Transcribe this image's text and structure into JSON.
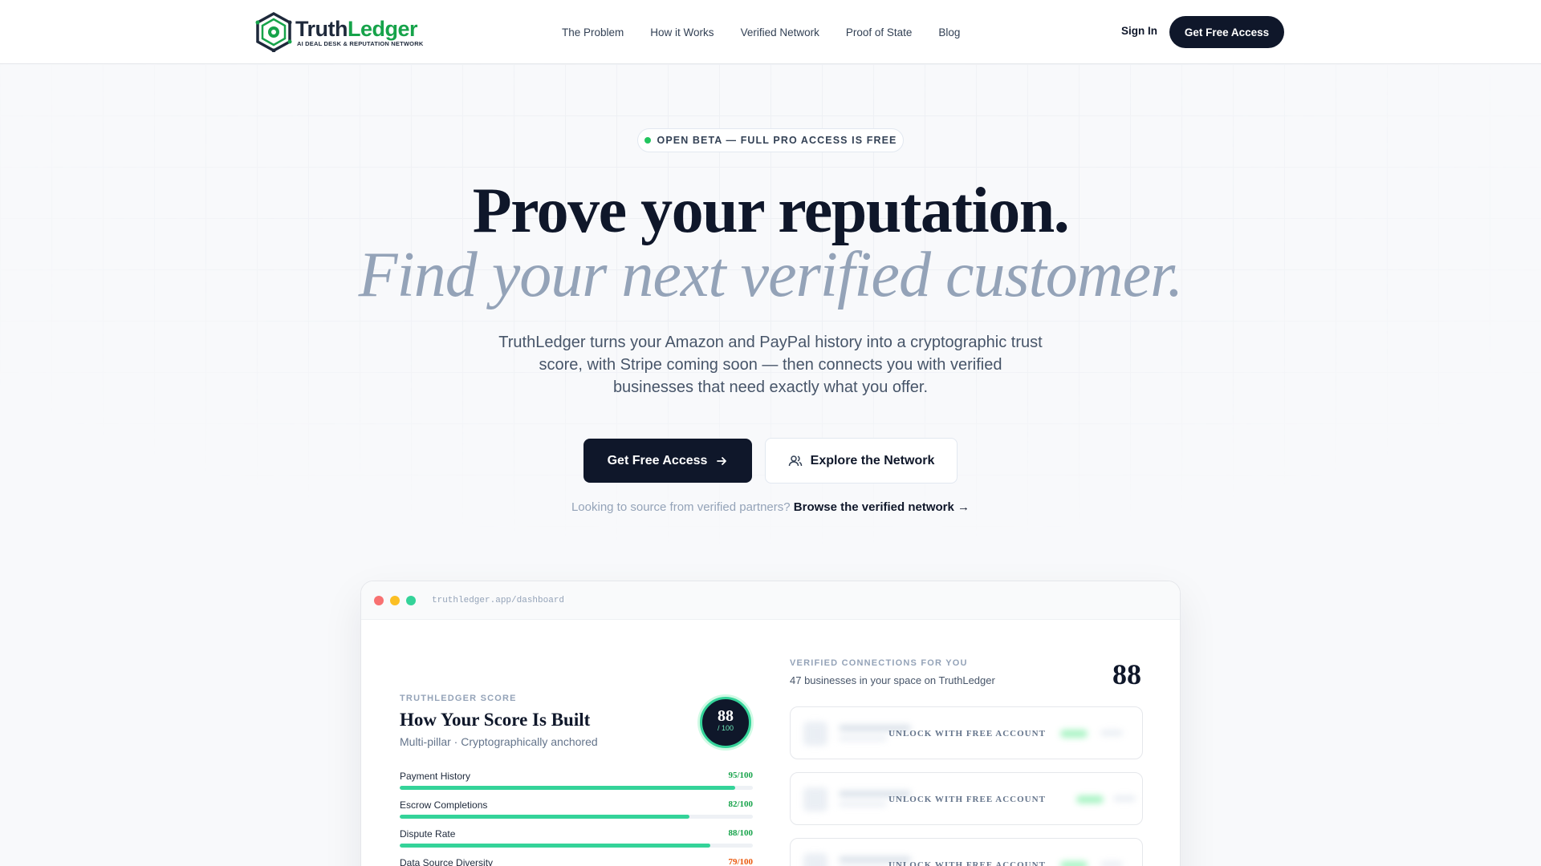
{
  "brand": {
    "name_part1": "Truth",
    "name_part2": "Ledger",
    "tagline": "AI DEAL DESK & REPUTATION NETWORK"
  },
  "nav": {
    "items": [
      "The Problem",
      "How it Works",
      "Verified Network",
      "Proof of State",
      "Blog"
    ]
  },
  "header": {
    "sign_in": "Sign In",
    "cta": "Get Free Access"
  },
  "hero": {
    "badge": "OPEN BETA — FULL PRO ACCESS IS FREE",
    "title_line1": "Prove your reputation.",
    "title_line2": "Find your next verified customer.",
    "lede": "TruthLedger turns your Amazon and PayPal history into a cryptographic trust score, with Stripe coming soon — then connects you with verified businesses that need exactly what you offer.",
    "primary_cta": "Get Free Access",
    "secondary_cta": "Explore the Network",
    "sub_text": "Looking to source from verified partners?",
    "sub_link": "Browse the verified network →"
  },
  "dashboard": {
    "url": "truthledger.app/dashboard",
    "score_eyebrow": "TRUTHLEDGER SCORE",
    "score_title": "How Your Score Is Built",
    "score_sub": "Multi-pillar · Cryptographically anchored",
    "score_value": "88",
    "score_max": "/ 100",
    "metrics": [
      {
        "label": "Payment History",
        "value_text": "95/100",
        "value": 95,
        "status": "good"
      },
      {
        "label": "Escrow Completions",
        "value_text": "82/100",
        "value": 82,
        "status": "good"
      },
      {
        "label": "Dispute Rate",
        "value_text": "88/100",
        "value": 88,
        "status": "good"
      },
      {
        "label": "Data Source Diversity",
        "value_text": "79/100",
        "value": 79,
        "status": "warn"
      }
    ],
    "connections_eyebrow": "VERIFIED CONNECTIONS FOR YOU",
    "connections_sub": "47 businesses in your space on TruthLedger",
    "connections_score": "88",
    "locked_cards": [
      "UNLOCK WITH FREE ACCOUNT",
      "UNLOCK WITH FREE ACCOUNT",
      "UNLOCK WITH FREE ACCOUNT"
    ]
  },
  "colors": {
    "navy": "#0f172a",
    "green": "#34d399",
    "brand_green": "#16a34a",
    "warn": "#ea580c"
  }
}
